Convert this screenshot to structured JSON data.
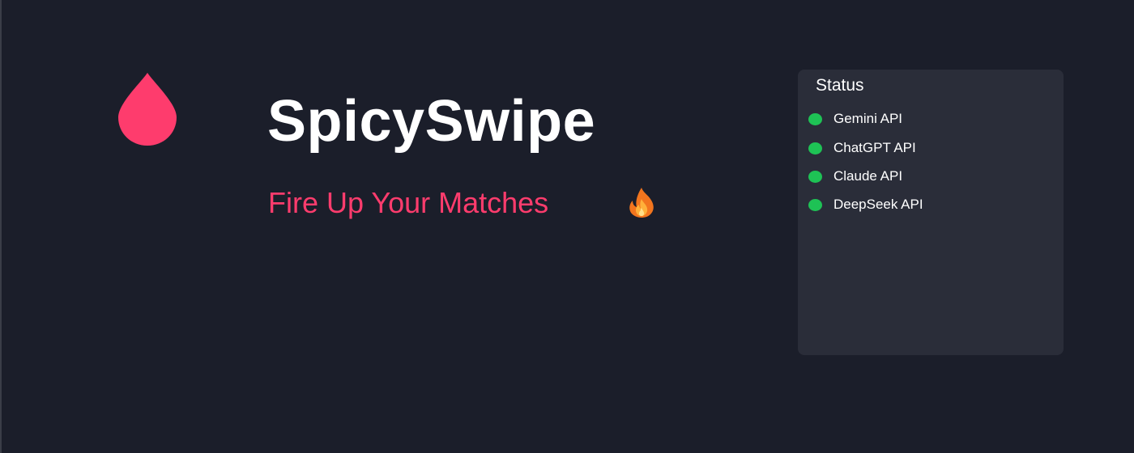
{
  "app": {
    "name": "SpicySwipe",
    "tagline": "Fire Up Your Matches",
    "logo_icon": "drop-icon",
    "tagline_icon": "fire-icon"
  },
  "colors": {
    "background": "#1b1e2a",
    "panel": "#2a2d39",
    "accent": "#fe3c6d",
    "status_ok": "#1ec255",
    "text": "#ffffff"
  },
  "status_panel": {
    "title": "Status",
    "items": [
      {
        "label": "Gemini API",
        "state": "online"
      },
      {
        "label": "ChatGPT API",
        "state": "online"
      },
      {
        "label": "Claude API",
        "state": "online"
      },
      {
        "label": "DeepSeek API",
        "state": "online"
      }
    ]
  }
}
